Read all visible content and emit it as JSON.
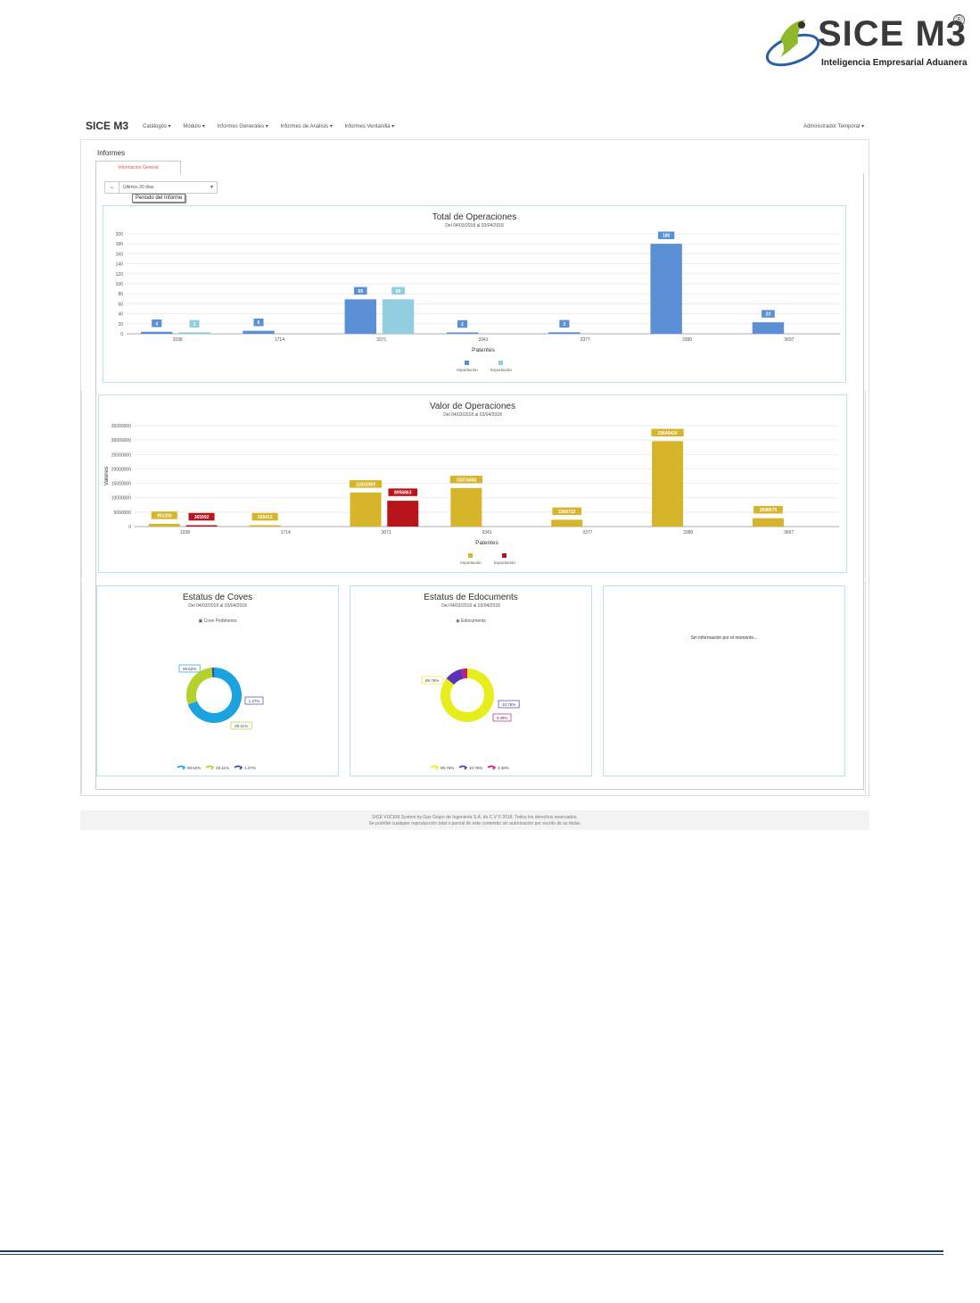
{
  "logo": {
    "brand": "SICE M3",
    "registered": "®",
    "tagline": "Inteligencia Empresarial Aduanera"
  },
  "navbar": {
    "brand": "SICE M3",
    "menu": [
      "Catálogos ▾",
      "Módulo ▾",
      "Informes Generales ▾",
      "Informes de Análisis ▾",
      "Informes Ventanilla ▾"
    ],
    "user": "Administrador Temporal ▾"
  },
  "page": {
    "title": "Informes",
    "tab": "Información General",
    "period_button": "↔",
    "period_value": "Últimos 30 días",
    "period_tooltip": "Periodo del Informe"
  },
  "colors": {
    "import_blue": "#5b8fd6",
    "export_lightblue": "#91cfe0",
    "import_gold": "#d6b52a",
    "export_red": "#b7151b",
    "card_border": "#b9e3ea"
  },
  "chart_data": [
    {
      "type": "bar",
      "title": "Total de Operaciones",
      "subtitle": "Del 04/03/2018 al 03/04/2018",
      "xlabel": "Patentes",
      "ylabel": "Operaciones",
      "categories": [
        "1038",
        "1714",
        "3071",
        "3341",
        "3377",
        "3380",
        "3697"
      ],
      "ylim": [
        0,
        200
      ],
      "yticks": [
        0,
        20,
        40,
        60,
        80,
        100,
        120,
        140,
        160,
        180,
        200
      ],
      "series": [
        {
          "name": "Importación",
          "values": [
            4,
            6,
            69,
            2,
            3,
            180,
            23
          ]
        },
        {
          "name": "Exportación",
          "values": [
            3,
            0,
            69,
            0,
            0,
            0,
            0
          ]
        }
      ],
      "legend": "bottom"
    },
    {
      "type": "bar",
      "title": "Valor de Operaciones",
      "subtitle": "Del 04/03/2018 al 03/04/2018",
      "xlabel": "Patentes",
      "ylabel": "Valores",
      "categories": [
        "1038",
        "1714",
        "3071",
        "3341",
        "3377",
        "3380",
        "3697"
      ],
      "ylim": [
        0,
        35000000
      ],
      "yticks": [
        0,
        5000000,
        10000000,
        15000000,
        20000000,
        25000000,
        30000000,
        35000000
      ],
      "series": [
        {
          "name": "Importación",
          "values": [
            951200,
            365412,
            11822369,
            13374468,
            2366722,
            29649424,
            2896675
          ]
        },
        {
          "name": "Exportación",
          "values": [
            365992,
            0,
            8956863,
            0,
            0,
            0,
            0
          ]
        }
      ],
      "legend": "bottom"
    },
    {
      "type": "pie",
      "title": "Estatus de Coves",
      "subtitle": "Del 04/03/2018 al 03/04/2018",
      "header_label": "Cove Pedimento",
      "slices": [
        {
          "label": "69.62%",
          "value": 69.62,
          "color": "#1aa3e0"
        },
        {
          "label": "29.11%",
          "value": 29.11,
          "color": "#b5d12e"
        },
        {
          "label": "1.27%",
          "value": 1.27,
          "color": "#3b4da8"
        }
      ]
    },
    {
      "type": "pie",
      "title": "Estatus de Edocuments",
      "subtitle": "Del 04/03/2018 al 03/04/2018",
      "header_label": "Edocuments",
      "slices": [
        {
          "label": "85.76%",
          "value": 85.76,
          "color": "#e8ee1c"
        },
        {
          "label": "10.76%",
          "value": 10.76,
          "color": "#5a33b8"
        },
        {
          "label": "3.48%",
          "value": 3.48,
          "color": "#c0207a"
        }
      ]
    }
  ],
  "empty_card": {
    "message": "Sin información por el momento..."
  },
  "footer": {
    "line1": "SICE VUCEM System by Gas Grupo de Ingeniería S.A. de C.V © 2018. Todos los derechos reservados.",
    "line2": "Se prohíbe cualquier reproducción total o parcial de este contenido sin autorización por escrito de su titular."
  }
}
